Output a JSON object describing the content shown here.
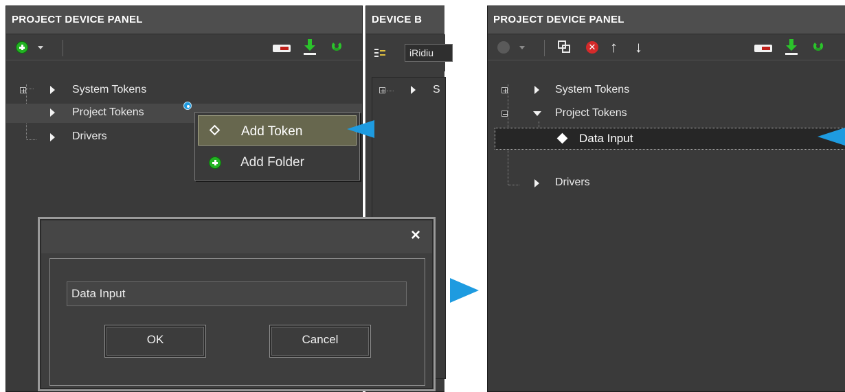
{
  "left_panel": {
    "title": "PROJECT DEVICE PANEL",
    "tree": [
      {
        "label": "System Tokens"
      },
      {
        "label": "Project Tokens"
      },
      {
        "label": "Drivers"
      }
    ]
  },
  "middle_panel": {
    "title": "DEVICE B",
    "dropdown_value": "iRidiu",
    "tree_first": "S"
  },
  "context_menu": {
    "items": [
      {
        "label": "Add Token"
      },
      {
        "label": "Add Folder"
      }
    ]
  },
  "dialog": {
    "close_glyph": "×",
    "input_value": "Data Input",
    "ok_label": "OK",
    "cancel_label": "Cancel"
  },
  "right_panel": {
    "title": "PROJECT DEVICE PANEL",
    "tree": [
      {
        "label": "System Tokens"
      },
      {
        "label": "Project Tokens"
      },
      {
        "label": "Data Input"
      },
      {
        "label": "Drivers"
      }
    ]
  },
  "colors": {
    "accent_arrow": "#1e9be0",
    "panel_bg": "#3c3c3c",
    "header_bg": "#4e4e4e",
    "green_icon": "#23b223"
  }
}
